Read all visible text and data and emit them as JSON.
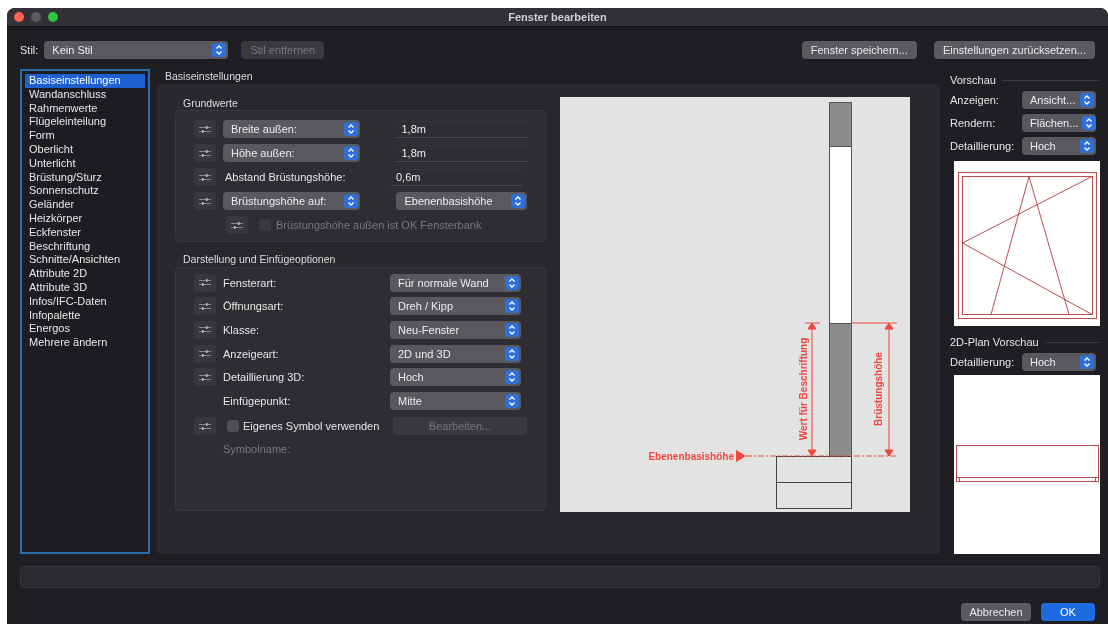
{
  "window": {
    "title": "Fenster bearbeiten"
  },
  "style_bar": {
    "label": "Stil:",
    "value": "Kein Stil",
    "remove_button": {
      "label": "Stil entfernen",
      "disabled": true
    },
    "buttons": [
      {
        "label": "Fenster speichern..."
      },
      {
        "label": "Einstellungen zurücksetzen..."
      }
    ]
  },
  "sidebar": {
    "items": [
      {
        "label": "Basiseinstellungen",
        "selected": true
      },
      {
        "label": "Wandanschluss",
        "selected": false
      },
      {
        "label": "Rahmenwerte",
        "selected": false
      },
      {
        "label": "Flügeleinteilung",
        "selected": false
      },
      {
        "label": "Form",
        "selected": false
      },
      {
        "label": "Oberlicht",
        "selected": false
      },
      {
        "label": "Unterlicht",
        "selected": false
      },
      {
        "label": "Brüstung/Sturz",
        "selected": false
      },
      {
        "label": "Sonnenschutz",
        "selected": false
      },
      {
        "label": "Geländer",
        "selected": false
      },
      {
        "label": "Heizkörper",
        "selected": false
      },
      {
        "label": "Eckfenster",
        "selected": false
      },
      {
        "label": "Beschriftung",
        "selected": false
      },
      {
        "label": "Schnitte/Ansichten",
        "selected": false
      },
      {
        "label": "Attribute 2D",
        "selected": false
      },
      {
        "label": "Attribute 3D",
        "selected": false
      },
      {
        "label": "Infos/IFC-Daten",
        "selected": false
      },
      {
        "label": "Infopalette",
        "selected": false
      },
      {
        "label": "Energos",
        "selected": false
      },
      {
        "label": "Mehrere ändern",
        "selected": false
      }
    ]
  },
  "section_title": "Basiseinstellungen",
  "grundwerte": {
    "title": "Grundwerte",
    "rows": [
      {
        "kind": "dropdown-value",
        "label": "Breite außen:",
        "value": "1,8m"
      },
      {
        "kind": "dropdown-value",
        "label": "Höhe außen:",
        "value": "1,8m"
      },
      {
        "kind": "label-value",
        "label": "Abstand Brüstungshöhe:",
        "value": "0,6m"
      },
      {
        "kind": "dropdown-dropdown",
        "label": "Brüstungshöhe auf:",
        "value": "Ebenenbasishöhe"
      },
      {
        "kind": "checkbox",
        "label": "Brüstungshöhe außen ist OK Fensterbank",
        "checked": false,
        "disabled": true
      }
    ]
  },
  "darstellung": {
    "title": "Darstellung und Einfügeoptionen",
    "rows": [
      {
        "kind": "select",
        "label": "Fensterart:",
        "value": "Für normale Wand"
      },
      {
        "kind": "select",
        "label": "Öffnungsart:",
        "value": "Dreh / Kipp"
      },
      {
        "kind": "select",
        "label": "Klasse:",
        "value": "Neu-Fenster"
      },
      {
        "kind": "select",
        "label": "Anzeigeart:",
        "value": "2D und 3D"
      },
      {
        "kind": "select",
        "label": "Detaillierung 3D:",
        "value": "Hoch"
      },
      {
        "kind": "select-plain",
        "label": "Einfügepunkt:",
        "value": "Mitte"
      },
      {
        "kind": "checkbox-button",
        "label": "Eigenes Symbol verwenden",
        "checked": false,
        "button": "Bearbeiten...",
        "disabled": true
      },
      {
        "kind": "note",
        "label": "Symbolname:",
        "disabled": true
      }
    ]
  },
  "diagram": {
    "base_label": "Ebenenbasishöhe",
    "left_dimension": "Wert für Beschriftung",
    "right_dimension": "Brüstungshöhe"
  },
  "preview": {
    "title": "Vorschau",
    "rows": [
      {
        "label": "Anzeigen:",
        "value": "Ansicht..."
      },
      {
        "label": "Rendern:",
        "value": "Flächen..."
      },
      {
        "label": "Detaillierung:",
        "value": "Hoch"
      }
    ]
  },
  "plan_preview": {
    "title": "2D-Plan Vorschau",
    "rows": [
      {
        "label": "Detaillierung:",
        "value": "Hoch"
      }
    ]
  },
  "footer": {
    "buttons": [
      {
        "label": "Abbrechen",
        "kind": "secondary"
      },
      {
        "label": "OK",
        "kind": "primary"
      }
    ]
  }
}
